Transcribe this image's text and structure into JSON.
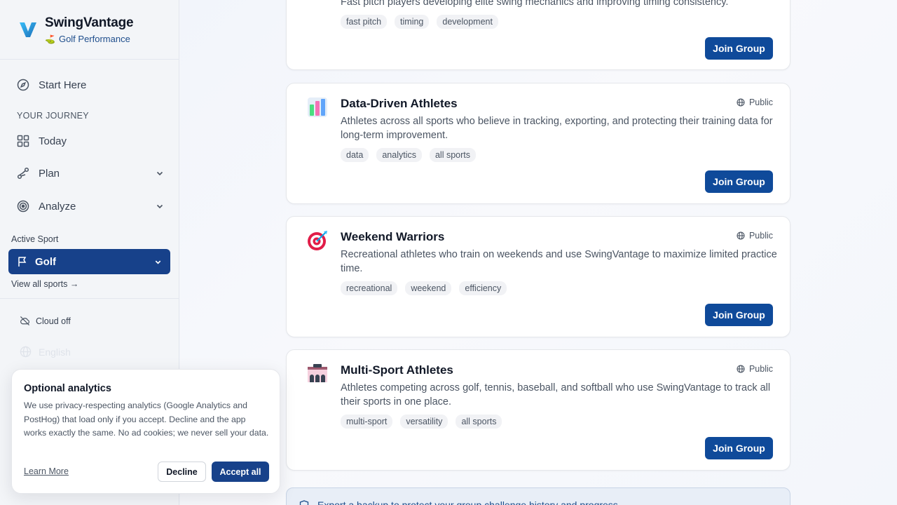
{
  "brand": {
    "name": "SwingVantage",
    "subtitle": "Golf Performance",
    "subtitle_emoji": "⛳"
  },
  "sidebar": {
    "start_here": "Start Here",
    "journey_label": "YOUR JOURNEY",
    "items": [
      {
        "label": "Today",
        "icon": "dashboard-icon"
      },
      {
        "label": "Plan",
        "icon": "route-icon",
        "expandable": true
      },
      {
        "label": "Analyze",
        "icon": "target-icon",
        "expandable": true
      }
    ],
    "active_sport_label": "Active Sport",
    "active_sport": "Golf",
    "view_all_sports": "View all sports →",
    "cloud_status": "Cloud off",
    "language": "English"
  },
  "groups": [
    {
      "title": "",
      "description": "Fast pitch players developing elite swing mechanics and improving timing consistency.",
      "tags": [
        "fast pitch",
        "timing",
        "development"
      ],
      "join_label": "Join Group"
    },
    {
      "title": "Data-Driven Athletes",
      "emoji": "📊",
      "visibility": "Public",
      "description": "Athletes across all sports who believe in tracking, exporting, and protecting their training data for long-term improvement.",
      "tags": [
        "data",
        "analytics",
        "all sports"
      ],
      "join_label": "Join Group"
    },
    {
      "title": "Weekend Warriors",
      "emoji": "🎯",
      "visibility": "Public",
      "description": "Recreational athletes who train on weekends and use SwingVantage to maximize limited practice time.",
      "tags": [
        "recreational",
        "weekend",
        "efficiency"
      ],
      "join_label": "Join Group"
    },
    {
      "title": "Multi-Sport Athletes",
      "emoji": "🏟",
      "visibility": "Public",
      "description": "Athletes competing across golf, tennis, baseball, and softball who use SwingVantage to track all their sports in one place.",
      "tags": [
        "multi-sport",
        "versatility",
        "all sports"
      ],
      "join_label": "Join Group"
    }
  ],
  "bottom_banner": "Export a backup to protect your group challenge history and progress.",
  "consent": {
    "title": "Optional analytics",
    "body": "We use privacy-respecting analytics (Google Analytics and PostHog) that load only if you accept. Decline and the app works exactly the same. No ad cookies; we never sell your data.",
    "learn_more": "Learn More",
    "decline": "Decline",
    "accept": "Accept all"
  },
  "colors": {
    "primary": "#17418a",
    "button": "#0f4a9a",
    "logo": "#2aa7d8"
  }
}
